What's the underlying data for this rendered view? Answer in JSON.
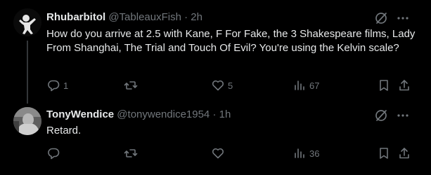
{
  "posts": [
    {
      "display_name": "Rhubarbitol",
      "handle": "@TableauxFish",
      "separator": "·",
      "time": "2h",
      "text": "How do you arrive at 2.5 with Kane, F For Fake, the 3 Shakespeare films, Lady From Shanghai, The Trial and Touch Of Evil? You're using the Kelvin scale?",
      "reply_count": "1",
      "repost_count": "",
      "like_count": "5",
      "view_count": "67",
      "avatar_icon": "person-silhouette-avatar"
    },
    {
      "display_name": "TonyWendice",
      "handle": "@tonywendice1954",
      "separator": "·",
      "time": "1h",
      "text": "Retard.",
      "reply_count": "",
      "repost_count": "",
      "like_count": "",
      "view_count": "36",
      "avatar_icon": "photo-avatar"
    }
  ],
  "icons": [
    "grok-icon",
    "more-icon",
    "reply-icon",
    "repost-icon",
    "like-icon",
    "views-icon",
    "bookmark-icon",
    "share-icon"
  ],
  "colors": {
    "background": "#000000",
    "text_primary": "#e7e9ea",
    "text_secondary": "#71767b",
    "divider": "#333639"
  }
}
